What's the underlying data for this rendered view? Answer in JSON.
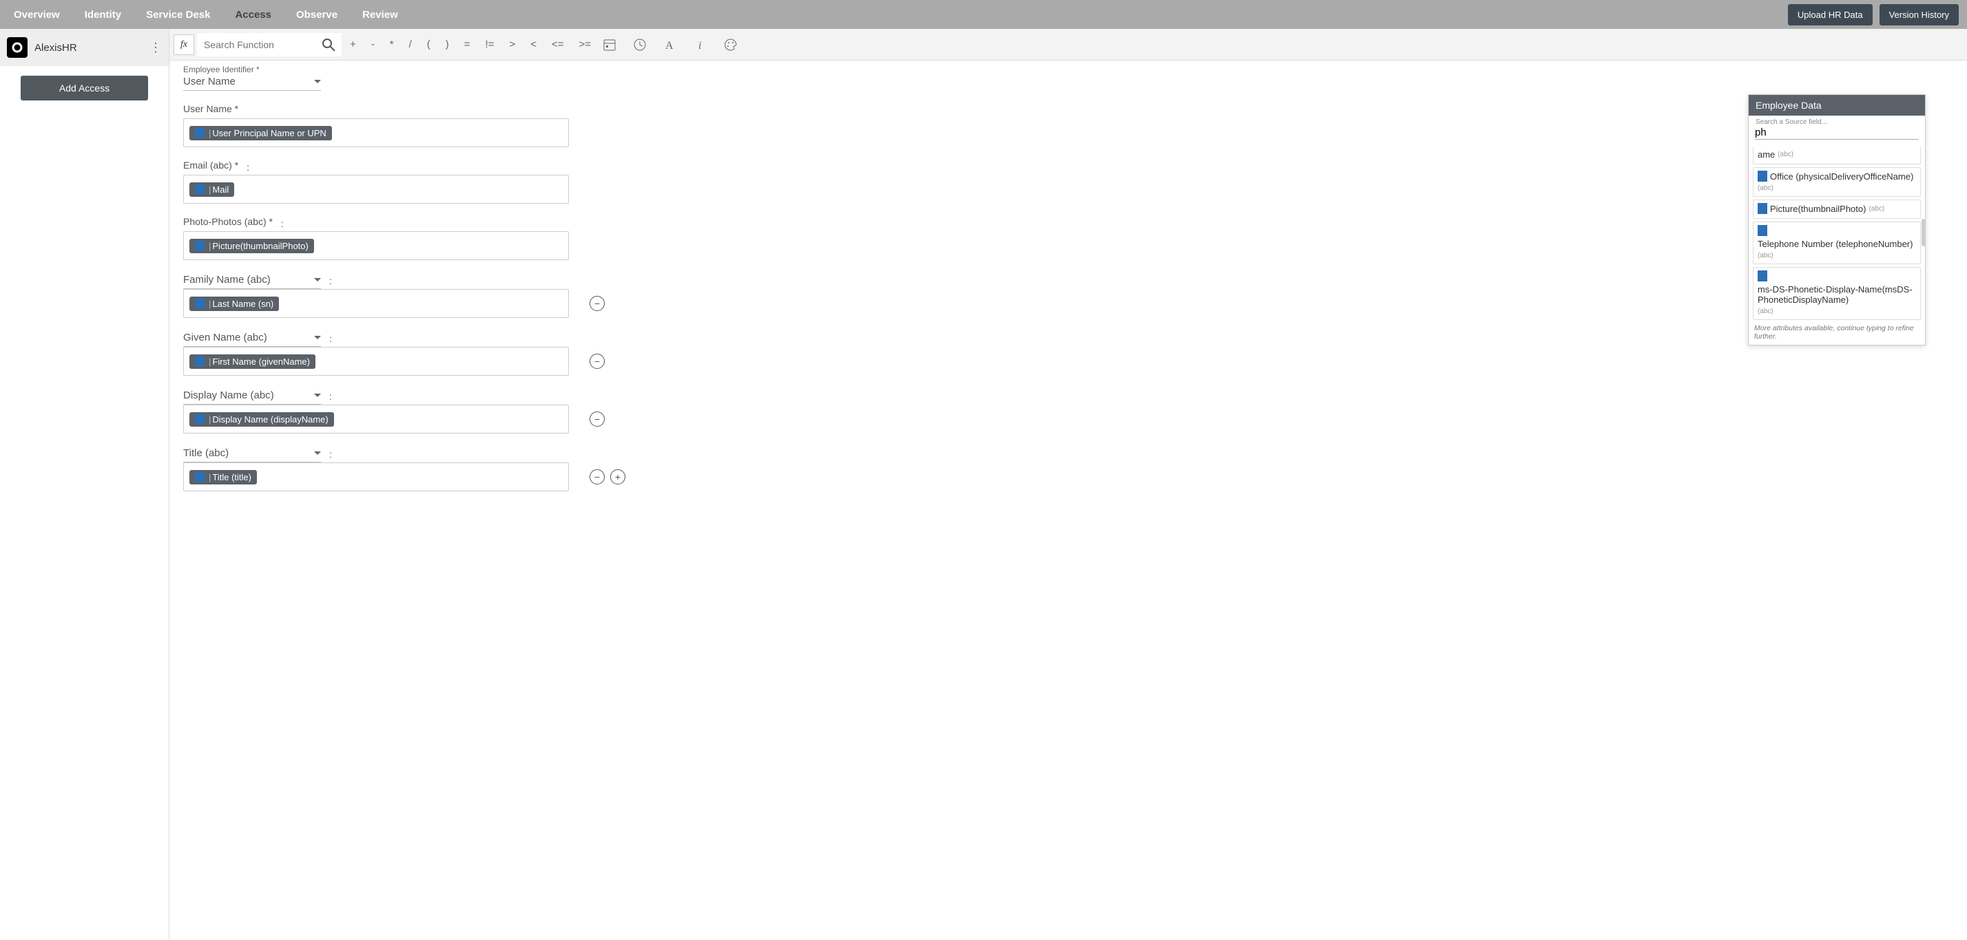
{
  "nav": {
    "items": [
      "Overview",
      "Identity",
      "Service Desk",
      "Access",
      "Observe",
      "Review"
    ],
    "active": "Access",
    "upload_btn": "Upload HR Data",
    "history_btn": "Version History"
  },
  "sidebar": {
    "source_name": "AlexisHR",
    "add_btn": "Add Access"
  },
  "formula": {
    "search_placeholder": "Search Function",
    "ops": [
      "+",
      "-",
      "*",
      "/",
      "(",
      ")",
      "=",
      "!=",
      ">",
      "<",
      "<=",
      ">="
    ]
  },
  "form": {
    "emp_id_label": "Employee Identifier *",
    "emp_id_value": "User Name",
    "fields": [
      {
        "label": "User Name *",
        "colon": false,
        "dropdown": false,
        "chip": "User Principal Name or UPN",
        "remove": false,
        "add": false
      },
      {
        "label": "Email (abc) *",
        "colon": true,
        "dropdown": false,
        "chip": "Mail",
        "remove": false,
        "add": false
      },
      {
        "label": "Photo-Photos (abc) *",
        "colon": true,
        "dropdown": false,
        "chip": "Picture(thumbnailPhoto)",
        "remove": false,
        "add": false
      },
      {
        "label": "Family Name (abc)",
        "colon": true,
        "dropdown": true,
        "chip": "Last Name (sn)",
        "remove": true,
        "add": false
      },
      {
        "label": "Given Name (abc)",
        "colon": true,
        "dropdown": true,
        "chip": "First Name (givenName)",
        "remove": true,
        "add": false
      },
      {
        "label": "Display Name (abc)",
        "colon": true,
        "dropdown": true,
        "chip": "Display Name (displayName)",
        "remove": true,
        "add": false
      },
      {
        "label": "Title (abc)",
        "colon": true,
        "dropdown": true,
        "chip": "Title (title)",
        "remove": true,
        "add": true
      }
    ]
  },
  "panel": {
    "title": "Employee Data",
    "search_label": "Search a Source field...",
    "search_value": "ph",
    "items": [
      {
        "label": "ame",
        "type": "(abc)",
        "partial": true
      },
      {
        "label": "Office (physicalDeliveryOfficeName)",
        "type": "(abc)"
      },
      {
        "label": "Picture(thumbnailPhoto)",
        "type": "(abc)"
      },
      {
        "label": "Telephone Number (telephoneNumber)",
        "type": "(abc)"
      },
      {
        "label": "ms-DS-Phonetic-Display-Name(msDS-PhoneticDisplayName)",
        "type": "(abc)"
      }
    ],
    "note": "More attributes available, continue typing to refine further."
  }
}
